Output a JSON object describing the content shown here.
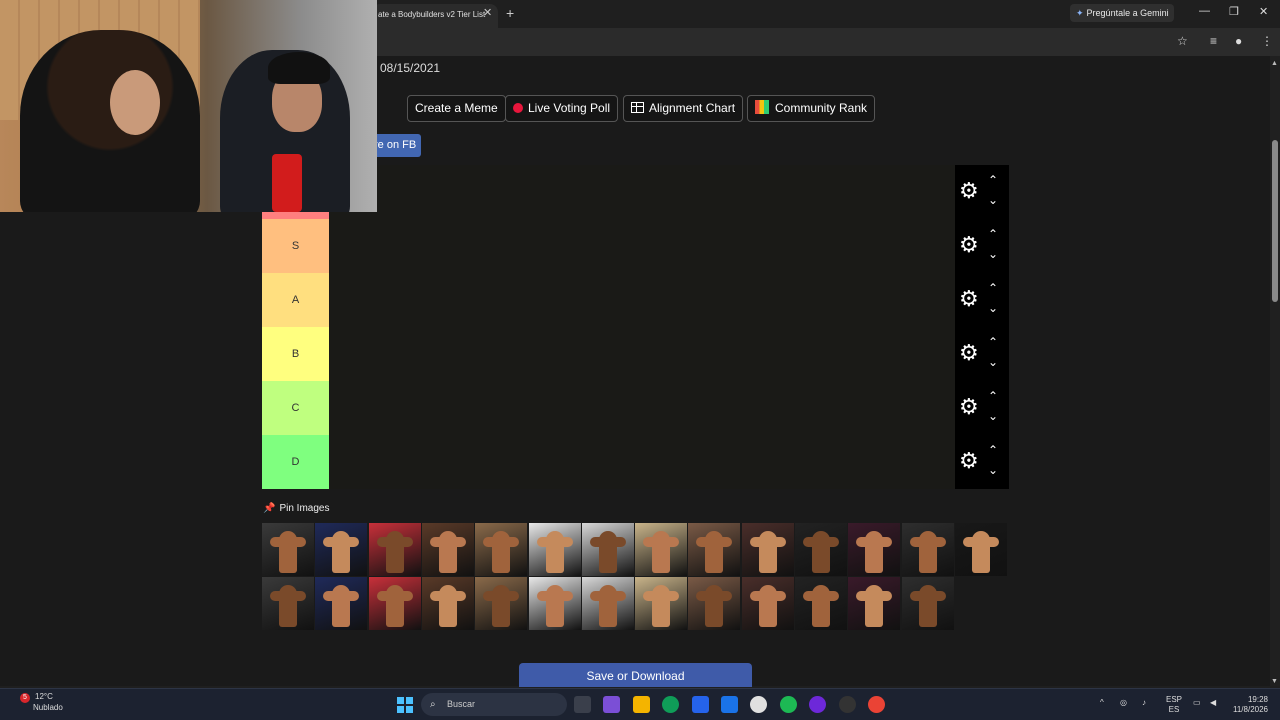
{
  "browser": {
    "tab_title": "ate a Bodybuilders v2 Tier List",
    "tab_close": "✕",
    "new_tab": "+",
    "gemini_label": "Pregúntale a Gemini",
    "win_minimize": "—",
    "win_restore": "❐",
    "win_close": "✕"
  },
  "page": {
    "date": "08/15/2021",
    "buttons": {
      "create_meme": "Create a Meme",
      "live_voting": "Live Voting Poll",
      "alignment_chart": "Alignment Chart",
      "community_rank": "Community Rank",
      "share_fb": "re on FB"
    },
    "tiers": [
      {
        "label": "",
        "color": "#ff7f7f"
      },
      {
        "label": "S",
        "color": "#ffbf7f"
      },
      {
        "label": "A",
        "color": "#ffdf7f"
      },
      {
        "label": "B",
        "color": "#ffff7f"
      },
      {
        "label": "C",
        "color": "#bfff7f"
      },
      {
        "label": "D",
        "color": "#7fff7f"
      }
    ],
    "tier_icons": {
      "settings": "gear-icon",
      "up": "chevron-up-icon",
      "down": "chevron-down-icon"
    },
    "pin_images_label": "Pin Images",
    "thumbnail_count": 27,
    "save_button": "Save or Download"
  },
  "taskbar": {
    "weather_temp": "12°C",
    "weather_desc": "Nublado",
    "notification_count": "5",
    "search_placeholder": "Buscar",
    "lang_top": "ESP",
    "lang_bottom": "ES",
    "time": "19:28",
    "date": "11/8/2026"
  },
  "colors": {
    "accent_blue": "#3f5ba9",
    "fb_blue": "#4267b2",
    "live_red": "#e8163c"
  }
}
